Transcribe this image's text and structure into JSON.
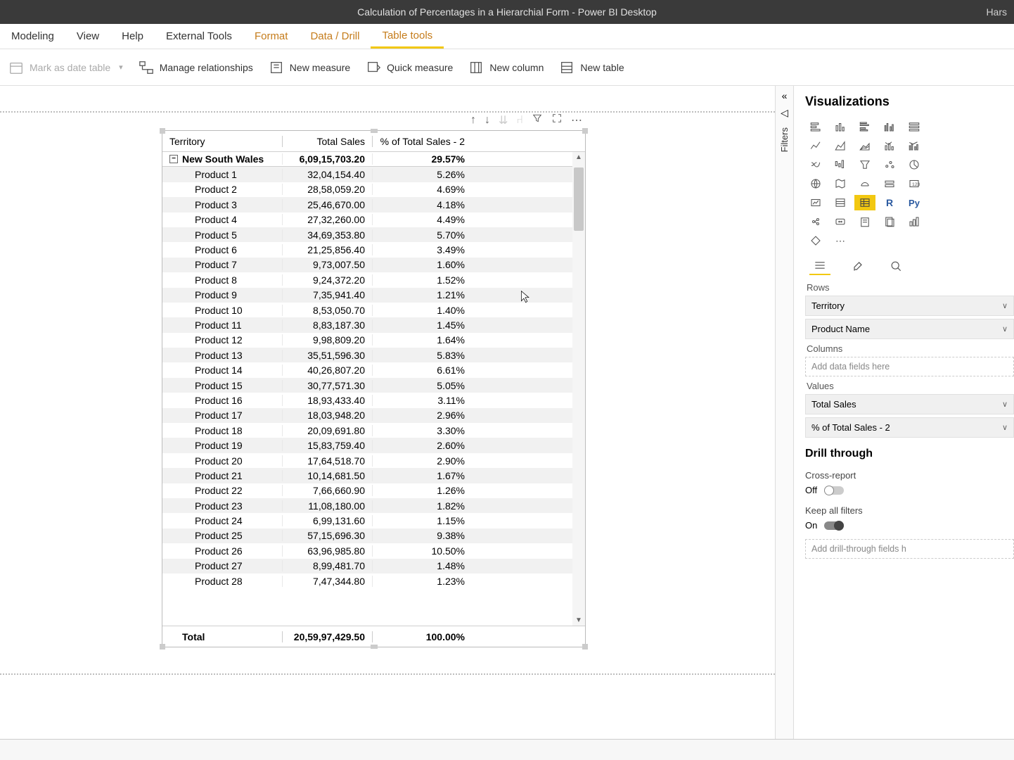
{
  "title": "Calculation of Percentages in a Hierarchial Form - Power BI Desktop",
  "title_right": "Hars",
  "menu": {
    "modeling": "Modeling",
    "view": "View",
    "help": "Help",
    "external": "External Tools",
    "format": "Format",
    "datadrill": "Data / Drill",
    "tabletools": "Table tools"
  },
  "ribbon": {
    "mark_date": "Mark as date table",
    "manage_rel": "Manage relationships",
    "new_measure": "New measure",
    "quick_measure": "Quick measure",
    "new_column": "New column",
    "new_table": "New table"
  },
  "matrix": {
    "headers": {
      "territory": "Territory",
      "sales": "Total Sales",
      "pct": "% of Total Sales - 2"
    },
    "group": {
      "name": "New South Wales",
      "sales": "6,09,15,703.20",
      "pct": "29.57%"
    },
    "rows": [
      {
        "name": "Product 1",
        "sales": "32,04,154.40",
        "pct": "5.26%"
      },
      {
        "name": "Product 2",
        "sales": "28,58,059.20",
        "pct": "4.69%"
      },
      {
        "name": "Product 3",
        "sales": "25,46,670.00",
        "pct": "4.18%"
      },
      {
        "name": "Product 4",
        "sales": "27,32,260.00",
        "pct": "4.49%"
      },
      {
        "name": "Product 5",
        "sales": "34,69,353.80",
        "pct": "5.70%"
      },
      {
        "name": "Product 6",
        "sales": "21,25,856.40",
        "pct": "3.49%"
      },
      {
        "name": "Product 7",
        "sales": "9,73,007.50",
        "pct": "1.60%"
      },
      {
        "name": "Product 8",
        "sales": "9,24,372.20",
        "pct": "1.52%"
      },
      {
        "name": "Product 9",
        "sales": "7,35,941.40",
        "pct": "1.21%"
      },
      {
        "name": "Product 10",
        "sales": "8,53,050.70",
        "pct": "1.40%"
      },
      {
        "name": "Product 11",
        "sales": "8,83,187.30",
        "pct": "1.45%"
      },
      {
        "name": "Product 12",
        "sales": "9,98,809.20",
        "pct": "1.64%"
      },
      {
        "name": "Product 13",
        "sales": "35,51,596.30",
        "pct": "5.83%"
      },
      {
        "name": "Product 14",
        "sales": "40,26,807.20",
        "pct": "6.61%"
      },
      {
        "name": "Product 15",
        "sales": "30,77,571.30",
        "pct": "5.05%"
      },
      {
        "name": "Product 16",
        "sales": "18,93,433.40",
        "pct": "3.11%"
      },
      {
        "name": "Product 17",
        "sales": "18,03,948.20",
        "pct": "2.96%"
      },
      {
        "name": "Product 18",
        "sales": "20,09,691.80",
        "pct": "3.30%"
      },
      {
        "name": "Product 19",
        "sales": "15,83,759.40",
        "pct": "2.60%"
      },
      {
        "name": "Product 20",
        "sales": "17,64,518.70",
        "pct": "2.90%"
      },
      {
        "name": "Product 21",
        "sales": "10,14,681.50",
        "pct": "1.67%"
      },
      {
        "name": "Product 22",
        "sales": "7,66,660.90",
        "pct": "1.26%"
      },
      {
        "name": "Product 23",
        "sales": "11,08,180.00",
        "pct": "1.82%"
      },
      {
        "name": "Product 24",
        "sales": "6,99,131.60",
        "pct": "1.15%"
      },
      {
        "name": "Product 25",
        "sales": "57,15,696.30",
        "pct": "9.38%"
      },
      {
        "name": "Product 26",
        "sales": "63,96,985.80",
        "pct": "10.50%"
      },
      {
        "name": "Product 27",
        "sales": "8,99,481.70",
        "pct": "1.48%"
      },
      {
        "name": "Product 28",
        "sales": "7,47,344.80",
        "pct": "1.23%"
      }
    ],
    "total": {
      "label": "Total",
      "sales": "20,59,97,429.50",
      "pct": "100.00%"
    }
  },
  "filters": {
    "label": "Filters"
  },
  "viz": {
    "title": "Visualizations",
    "sections": {
      "rows": "Rows",
      "columns": "Columns",
      "values": "Values"
    },
    "rows_fields": [
      "Territory",
      "Product Name"
    ],
    "columns_placeholder": "Add data fields here",
    "values_fields": [
      "Total Sales",
      "% of Total Sales - 2"
    ],
    "drill": {
      "title": "Drill through",
      "cross_label": "Cross-report",
      "cross_state": "Off",
      "keep_label": "Keep all filters",
      "keep_state": "On",
      "placeholder": "Add drill-through fields h"
    }
  }
}
